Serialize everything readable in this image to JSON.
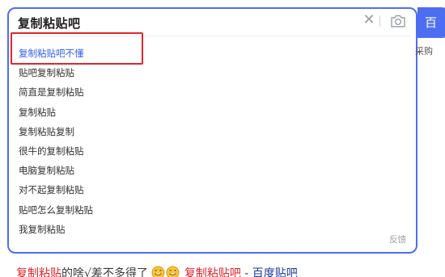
{
  "search": {
    "query": "复制粘贴吧",
    "button_label": "百",
    "feedback_label": "反馈"
  },
  "suggestions": [
    "复制粘贴吧不懂",
    "贴吧复制粘贴",
    "简直是复制粘贴",
    "复制粘贴",
    "复制粘贴复制",
    "很牛的复制粘贴",
    "电脑复制粘贴",
    "对不起复制粘贴",
    "贴吧怎么复制粘贴",
    "我复制粘贴"
  ],
  "side_text": "采购",
  "result": {
    "keyword": "复制粘贴",
    "text": "的啥√差不多得了",
    "link_keyword": "复制粘贴吧",
    "site": " - 百度贴吧"
  },
  "colors": {
    "accent": "#4e6ef2",
    "active_suggestion": "#315efb",
    "highlight_red": "#e0262a"
  }
}
